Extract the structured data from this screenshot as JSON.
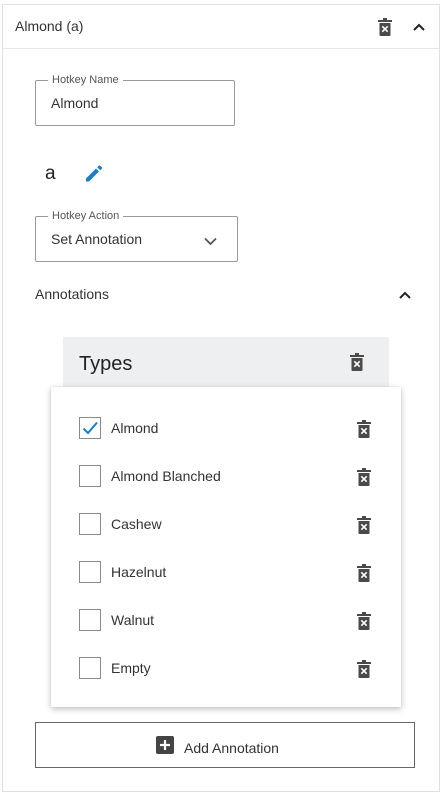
{
  "header": {
    "title": "Almond (a)"
  },
  "hotkey_name": {
    "legend": "Hotkey Name",
    "value": "Almond"
  },
  "hotkey": {
    "key": "a"
  },
  "hotkey_action": {
    "legend": "Hotkey Action",
    "value": "Set Annotation"
  },
  "annotations": {
    "label": "Annotations"
  },
  "types": {
    "title": "Types",
    "items": [
      {
        "label": "Almond",
        "checked": true
      },
      {
        "label": "Almond Blanched",
        "checked": false
      },
      {
        "label": "Cashew",
        "checked": false
      },
      {
        "label": "Hazelnut",
        "checked": false
      },
      {
        "label": "Walnut",
        "checked": false
      },
      {
        "label": "Empty",
        "checked": false
      }
    ]
  },
  "add_button": {
    "label": "Add Annotation"
  },
  "colors": {
    "accent": "#1a7fc6",
    "icon": "#4a4a4a",
    "types_bg": "#eeeff1"
  }
}
